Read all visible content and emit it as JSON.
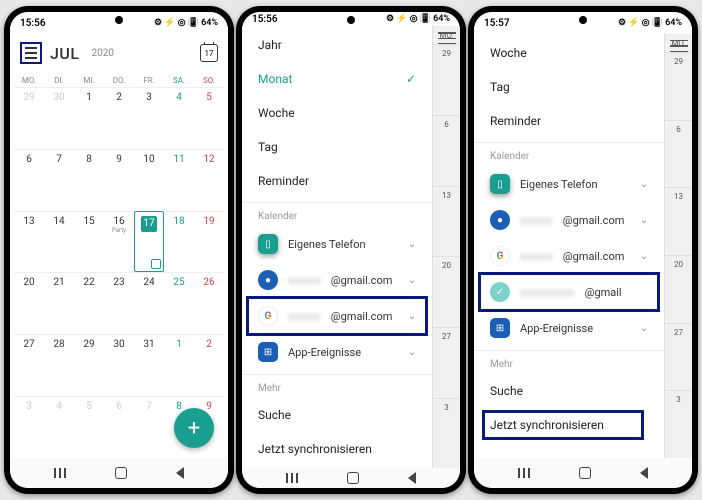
{
  "status": {
    "time1": "15:56",
    "time2": "15:56",
    "time3": "15:57",
    "battery": "64%",
    "icons": "⚙ ⚡ ◎ 📳"
  },
  "calendar": {
    "month": "JUL",
    "year": "2020",
    "today_num": "17",
    "weekdays": [
      "MO.",
      "DI.",
      "MI.",
      "DO.",
      "FR.",
      "SA.",
      "SO."
    ],
    "event_label": "Party",
    "days": [
      [
        "29",
        "30",
        "1",
        "2",
        "3",
        "4",
        "5"
      ],
      [
        "6",
        "7",
        "8",
        "9",
        "10",
        "11",
        "12"
      ],
      [
        "13",
        "14",
        "15",
        "16",
        "17",
        "18",
        "19"
      ],
      [
        "20",
        "21",
        "22",
        "23",
        "24",
        "25",
        "26"
      ],
      [
        "27",
        "28",
        "29",
        "30",
        "31",
        "1",
        "2"
      ],
      [
        "3",
        "4",
        "5",
        "6",
        "7",
        "8",
        "9"
      ]
    ]
  },
  "drawer": {
    "jahr": "Jahr",
    "monat": "Monat",
    "woche": "Woche",
    "tag": "Tag",
    "reminder": "Reminder",
    "kalender_h": "Kalender",
    "eigenes": "Eigenes Telefon",
    "gmail1": "@gmail.com",
    "gmail2": "@gmail.com",
    "gmail3": "@gmail",
    "app_ev": "App-Ereignisse",
    "mehr_h": "Mehr",
    "suche": "Suche",
    "sync": "Jetzt synchronisieren"
  },
  "sidecol": {
    "mo": "MO.",
    "d6": "6",
    "d13": "13",
    "d20": "20",
    "d27": "27"
  }
}
